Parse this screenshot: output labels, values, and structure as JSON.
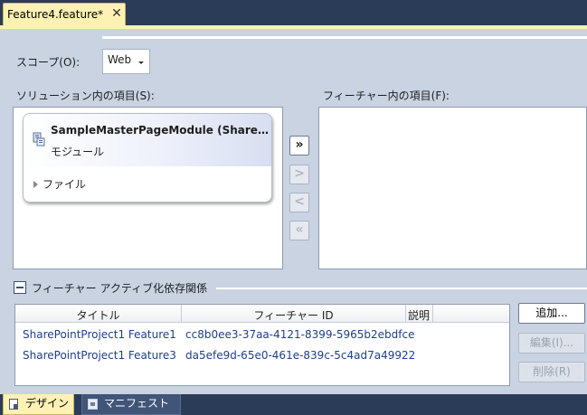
{
  "document_tab": {
    "title": "Feature4.feature*",
    "close_glyph": "✕"
  },
  "scope": {
    "label": "スコープ(O):",
    "value": "Web"
  },
  "solution_items": {
    "label": "ソリューション内の項目(S):",
    "module": {
      "title": "SampleMasterPageModule (SharePoint)",
      "type": "モジュール",
      "child_label": "ファイル",
      "icon": "module-icon"
    }
  },
  "feature_items": {
    "label": "フィーチャー内の項目(F):",
    "items": []
  },
  "move_buttons": [
    {
      "glyph": "»",
      "name": "add-all",
      "enabled": true
    },
    {
      "glyph": ">",
      "name": "add-selected",
      "enabled": false
    },
    {
      "glyph": "<",
      "name": "remove-selected",
      "enabled": false
    },
    {
      "glyph": "«",
      "name": "remove-all",
      "enabled": false
    }
  ],
  "dependencies": {
    "title": "フィーチャー アクティブ化依存関係",
    "columns": [
      "タイトル",
      "フィーチャー ID",
      "説明"
    ],
    "rows": [
      {
        "title": "SharePointProject1 Feature1",
        "id": "cc8b0ee3-37aa-4121-8399-5965b2ebdfce",
        "description": ""
      },
      {
        "title": "SharePointProject1 Feature3",
        "id": "da5efe9d-65e0-461e-839c-5c4ad7a49922",
        "description": ""
      }
    ],
    "buttons": {
      "add": "追加...",
      "edit": "編集(I)...",
      "remove": "削除(R)"
    }
  },
  "bottom_tabs": [
    {
      "label": "デザイン",
      "icon": "design-icon",
      "active": true
    },
    {
      "label": "マニフェスト",
      "icon": "manifest-icon",
      "active": false
    }
  ],
  "colors": {
    "chrome": "#2b3c59",
    "active_tab": "#fdf1b3",
    "surface": "#c9d3e2",
    "link_text": "#1d3f8a"
  }
}
